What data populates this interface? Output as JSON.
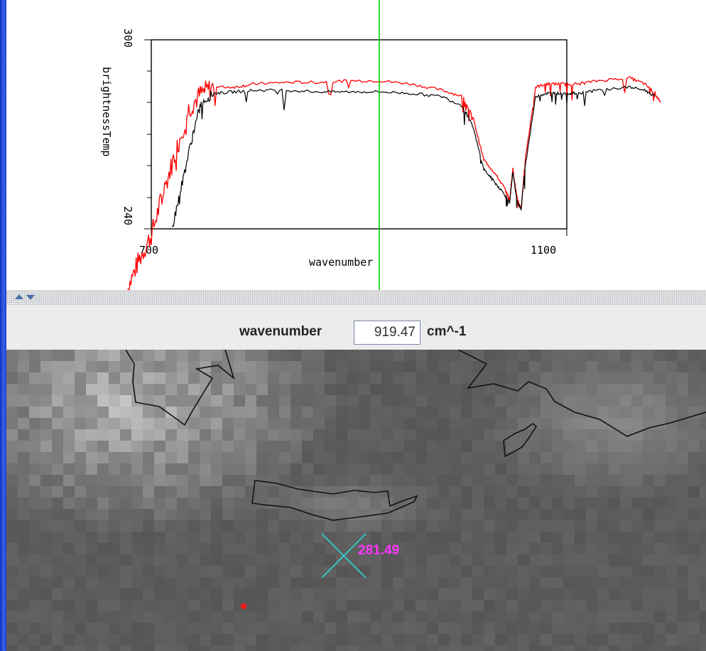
{
  "plot": {
    "ylabel": "brightnessTemp",
    "xlabel": "wavenumber",
    "y_tick_top": "300",
    "y_tick_bottom": "240",
    "x_tick_left": "700",
    "x_tick_right": "1100"
  },
  "control": {
    "wavenumber_label": "wavenumber",
    "wavenumber_value": "919.47",
    "unit": "cm^-1"
  },
  "image": {
    "probe_value": "281.49"
  },
  "colors": {
    "series_red": "#ff0000",
    "series_black": "#000000",
    "cursor_line": "#00cc00",
    "probe_cross": "#33cccc",
    "probe_text": "#ff33ff",
    "left_edge": "#1c3fd0"
  },
  "chart_data": {
    "type": "line",
    "xlabel": "wavenumber",
    "ylabel": "brightnessTemp",
    "xlim": [
      700,
      1100
    ],
    "ylim": [
      240,
      300
    ],
    "cursor_x": 919.47,
    "series": [
      {
        "color": "#ff0000",
        "x": [
          676,
          688,
          700,
          712,
          724,
          736,
          748,
          760,
          780,
          800,
          830,
          860,
          890,
          920,
          950,
          980,
          1000,
          1010,
          1020,
          1030,
          1040,
          1045,
          1048,
          1052,
          1056,
          1060,
          1070,
          1080,
          1090,
          1100,
          1110,
          1130,
          1160,
          1175,
          1185,
          1190
        ],
        "y": [
          220,
          230,
          238,
          252,
          265,
          278,
          283,
          285,
          285,
          286,
          286.5,
          286.5,
          287,
          287,
          286,
          284,
          282,
          275,
          262,
          258,
          253,
          249,
          259,
          250,
          246,
          262,
          285,
          286,
          286,
          286,
          286,
          287,
          288,
          286,
          283,
          280
        ]
      },
      {
        "color": "#000000",
        "x": [
          720,
          730,
          740,
          748,
          760,
          780,
          800,
          830,
          860,
          890,
          920,
          950,
          980,
          1000,
          1010,
          1020,
          1030,
          1040,
          1045,
          1048,
          1052,
          1056,
          1060,
          1070,
          1080,
          1090,
          1100,
          1110,
          1130,
          1160,
          1175,
          1185
        ],
        "y": [
          240,
          255,
          270,
          280,
          283,
          283.5,
          284,
          284,
          283.5,
          283.5,
          283.5,
          283,
          282,
          279,
          272,
          259,
          255,
          251,
          248,
          258,
          249,
          246,
          260,
          282,
          283,
          283,
          283,
          283,
          284,
          285,
          284,
          282
        ]
      }
    ]
  }
}
